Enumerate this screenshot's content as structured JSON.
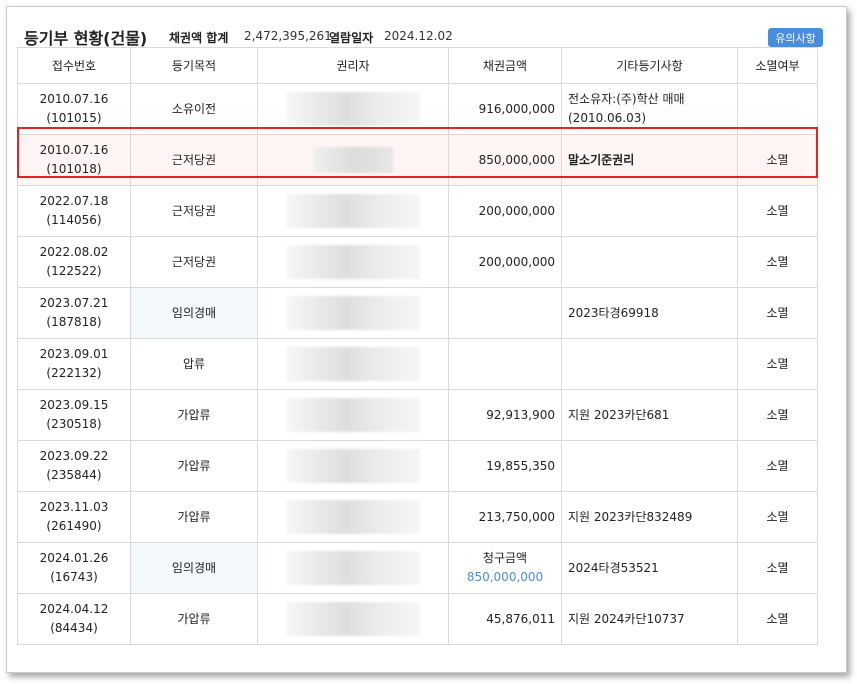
{
  "header": {
    "title": "등기부 현황(건물)",
    "sum_label": "채권액 합계",
    "sum_value": "2,472,395,261",
    "date_label": "열람일자",
    "date_value": "2024.12.02",
    "notice_button": "유의사항"
  },
  "table": {
    "columns": [
      "접수번호",
      "등기목적",
      "권리자",
      "채권금액",
      "기타등기사항",
      "소멸여부"
    ],
    "rows": [
      {
        "date": "2010.07.16",
        "receipt": "(101015)",
        "purpose": "소유이전",
        "amount": "916,000,000",
        "etc": "전소유자:(주)학산 매매(2010.06.03)",
        "status": ""
      },
      {
        "date": "2010.07.16",
        "receipt": "(101018)",
        "purpose": "근저당권",
        "amount": "850,000,000",
        "etc": "말소기준권리",
        "status": "소멸"
      },
      {
        "date": "2022.07.18",
        "receipt": "(114056)",
        "purpose": "근저당권",
        "amount": "200,000,000",
        "etc": "",
        "status": "소멸"
      },
      {
        "date": "2022.08.02",
        "receipt": "(122522)",
        "purpose": "근저당권",
        "amount": "200,000,000",
        "etc": "",
        "status": "소멸"
      },
      {
        "date": "2023.07.21",
        "receipt": "(187818)",
        "purpose": "임의경매",
        "amount": "",
        "etc": "2023타경69918",
        "status": "소멸"
      },
      {
        "date": "2023.09.01",
        "receipt": "(222132)",
        "purpose": "압류",
        "amount": "",
        "etc": "",
        "status": "소멸"
      },
      {
        "date": "2023.09.15",
        "receipt": "(230518)",
        "purpose": "가압류",
        "amount": "92,913,900",
        "etc": "지원 2023카단681",
        "status": "소멸"
      },
      {
        "date": "2023.09.22",
        "receipt": "(235844)",
        "purpose": "가압류",
        "amount": "19,855,350",
        "etc": "",
        "status": "소멸"
      },
      {
        "date": "2023.11.03",
        "receipt": "(261490)",
        "purpose": "가압류",
        "amount": "213,750,000",
        "etc": "지원 2023카단832489",
        "status": "소멸"
      },
      {
        "date": "2024.01.26",
        "receipt": "(16743)",
        "purpose": "임의경매",
        "amount_label": "청구금액",
        "amount": "850,000,000",
        "etc": "2024타경53521",
        "status": "소멸"
      },
      {
        "date": "2024.04.12",
        "receipt": "(84434)",
        "purpose": "가압류",
        "amount": "45,876,011",
        "etc": "지원 2024카단10737",
        "status": "소멸"
      }
    ]
  },
  "colors": {
    "accent": "#4a8ddc",
    "reference_border": "#e02424",
    "reference_bg": "#fff5f5",
    "auction_bg": "#f3f8fd"
  }
}
